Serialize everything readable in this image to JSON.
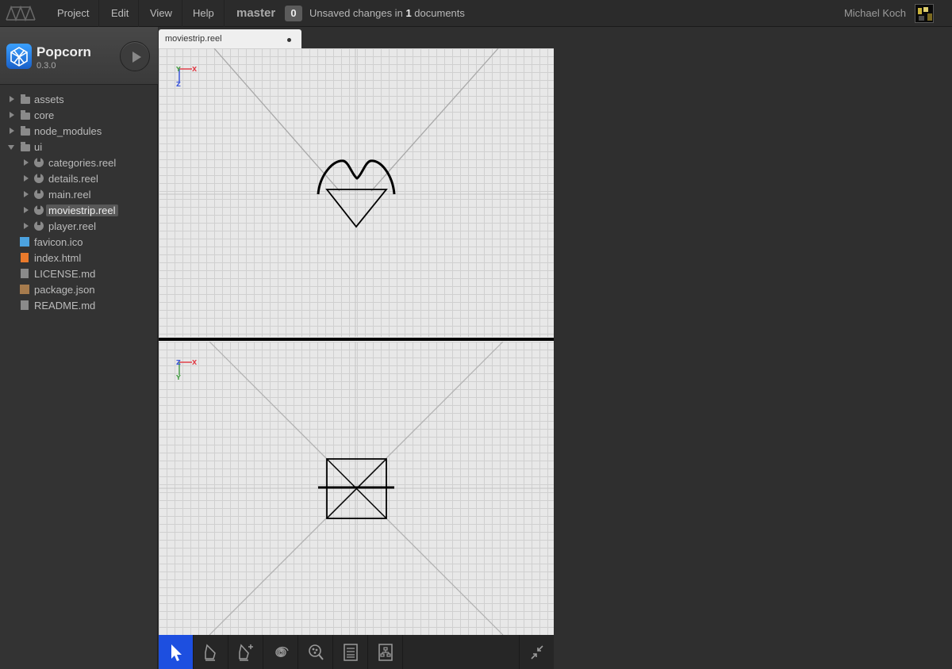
{
  "menubar": {
    "items": [
      "Project",
      "Edit",
      "View",
      "Help"
    ],
    "branch": "master",
    "unsaved_count": "0",
    "unsaved_prefix": "Unsaved changes in",
    "unsaved_number": "1",
    "unsaved_suffix": "documents",
    "user": "Michael Koch"
  },
  "project": {
    "name": "Popcorn",
    "version": "0.3.0"
  },
  "tree": [
    {
      "label": "assets",
      "type": "folder",
      "expanded": false,
      "depth": 0
    },
    {
      "label": "core",
      "type": "folder",
      "expanded": false,
      "depth": 0
    },
    {
      "label": "node_modules",
      "type": "folder",
      "expanded": false,
      "depth": 0
    },
    {
      "label": "ui",
      "type": "folder",
      "expanded": true,
      "depth": 0
    },
    {
      "label": "categories.reel",
      "type": "reel",
      "expanded": false,
      "depth": 1
    },
    {
      "label": "details.reel",
      "type": "reel",
      "expanded": false,
      "depth": 1
    },
    {
      "label": "main.reel",
      "type": "reel",
      "expanded": false,
      "depth": 1
    },
    {
      "label": "moviestrip.reel",
      "type": "reel",
      "expanded": false,
      "depth": 1,
      "selected": true
    },
    {
      "label": "player.reel",
      "type": "reel",
      "expanded": false,
      "depth": 1
    },
    {
      "label": "favicon.ico",
      "type": "image",
      "depth": 0
    },
    {
      "label": "index.html",
      "type": "html",
      "depth": 0
    },
    {
      "label": "LICENSE.md",
      "type": "file",
      "depth": 0
    },
    {
      "label": "package.json",
      "type": "package",
      "depth": 0
    },
    {
      "label": "README.md",
      "type": "file",
      "depth": 0
    }
  ],
  "tab": {
    "title": "moviestrip.reel"
  },
  "viewports": {
    "top": {
      "axis_up": "Y",
      "axis_right": "X",
      "axis_down": "Z"
    },
    "bottom": {
      "axis_up": "Z",
      "axis_right": "X",
      "axis_down": "Y"
    }
  },
  "toolbar": {
    "tools": [
      "select-tool",
      "pen-tool",
      "add-pen-tool",
      "spiral-tool",
      "inspect-tool",
      "document-tool",
      "hierarchy-tool"
    ],
    "active": "select-tool"
  },
  "colors": {
    "accent": "#1d4fe0",
    "axis_x": "#e0404a",
    "axis_y": "#4aa14a",
    "axis_z": "#3a55d8"
  }
}
